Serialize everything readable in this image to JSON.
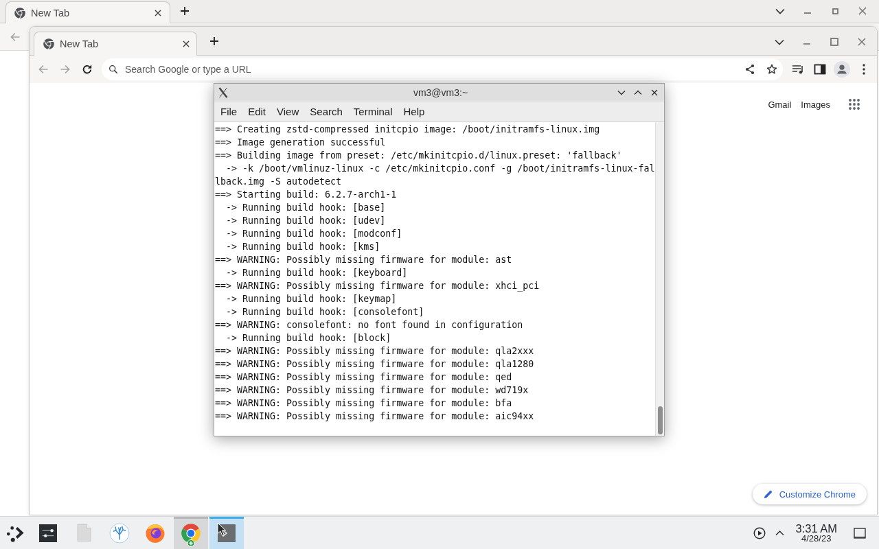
{
  "background_browser": {
    "tabs": [
      {
        "title": "New Tab",
        "selected": true
      }
    ],
    "nav": {
      "back_disabled": true
    }
  },
  "browser": {
    "tabs": [
      {
        "title": "New Tab",
        "selected": true
      }
    ],
    "nav": {
      "back_disabled": true,
      "forward_disabled": true
    },
    "address_bar": {
      "placeholder": "Search Google or type a URL"
    },
    "header_links": [
      "Gmail",
      "Images"
    ],
    "customize_button": "Customize Chrome"
  },
  "terminal": {
    "title": "vm3@vm3:~",
    "menu": [
      "File",
      "Edit",
      "View",
      "Search",
      "Terminal",
      "Help"
    ],
    "lines": [
      "==> Creating zstd-compressed initcpio image: /boot/initramfs-linux.img",
      "==> Image generation successful",
      "==> Building image from preset: /etc/mkinitcpio.d/linux.preset: 'fallback'",
      "  -> -k /boot/vmlinuz-linux -c /etc/mkinitcpio.conf -g /boot/initramfs-linux-fal",
      "lback.img -S autodetect",
      "==> Starting build: 6.2.7-arch1-1",
      "  -> Running build hook: [base]",
      "  -> Running build hook: [udev]",
      "  -> Running build hook: [modconf]",
      "  -> Running build hook: [kms]",
      "==> WARNING: Possibly missing firmware for module: ast",
      "  -> Running build hook: [keyboard]",
      "==> WARNING: Possibly missing firmware for module: xhci_pci",
      "  -> Running build hook: [keymap]",
      "  -> Running build hook: [consolefont]",
      "==> WARNING: consolefont: no font found in configuration",
      "  -> Running build hook: [block]",
      "==> WARNING: Possibly missing firmware for module: qla2xxx",
      "==> WARNING: Possibly missing firmware for module: qla1280",
      "==> WARNING: Possibly missing firmware for module: qed",
      "==> WARNING: Possibly missing firmware for module: wd719x",
      "==> WARNING: Possibly missing firmware for module: bfa",
      "==> WARNING: Possibly missing firmware for module: aic94xx"
    ]
  },
  "taskbar": {
    "apps": [
      {
        "kind": "launcher",
        "running": false,
        "selected": false
      },
      {
        "kind": "sliders",
        "running": false,
        "selected": false
      },
      {
        "kind": "document",
        "running": false,
        "selected": false
      },
      {
        "kind": "coral",
        "running": false,
        "selected": false
      },
      {
        "kind": "firefox",
        "running": false,
        "selected": false
      },
      {
        "kind": "chrome",
        "running": true,
        "selected": false
      },
      {
        "kind": "terminal",
        "running": true,
        "selected": true
      }
    ],
    "clock": {
      "time": "3:31 AM",
      "date": "4/28/23"
    }
  }
}
